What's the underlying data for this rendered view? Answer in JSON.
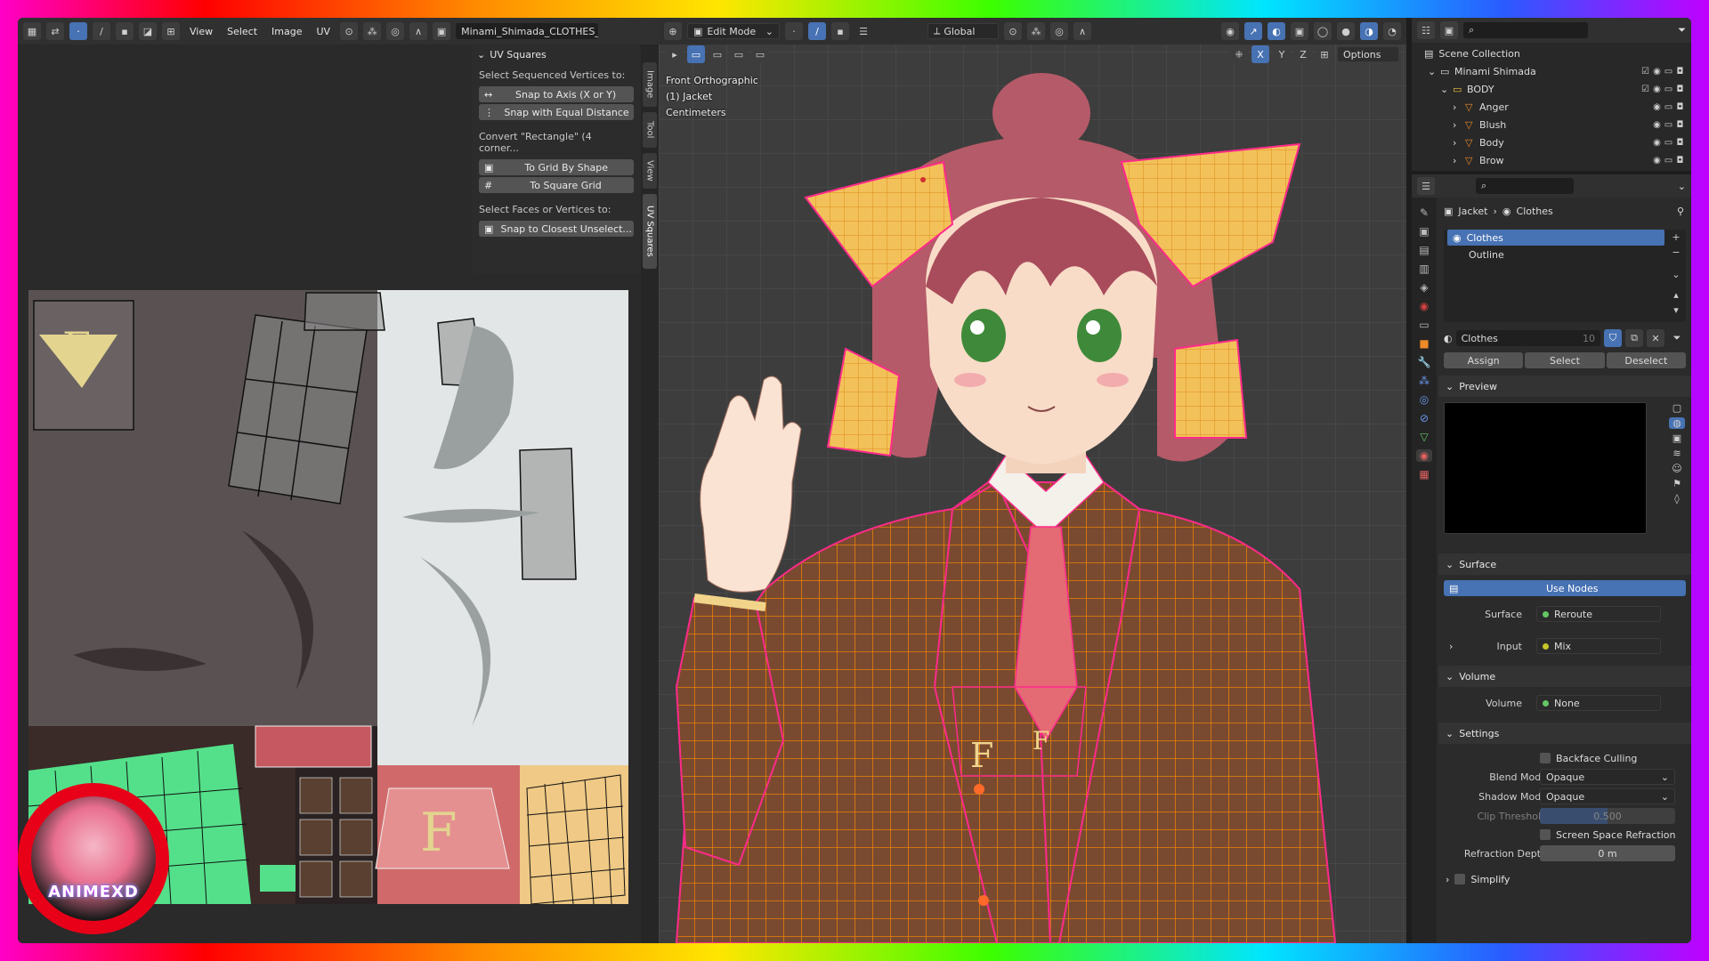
{
  "uv_editor": {
    "menus": [
      "View",
      "Select",
      "Image",
      "UV"
    ],
    "image_name": "Minami_Shimada_CLOTHES_BA",
    "npanel": {
      "title": "UV Squares",
      "sections": [
        {
          "label": "Select Sequenced Vertices to:",
          "buttons": [
            {
              "icon": "↔",
              "text": "Snap to Axis (X or Y)"
            },
            {
              "icon": "⋮",
              "text": "Snap with Equal Distance"
            }
          ]
        },
        {
          "label": "Convert \"Rectangle\" (4 corner...",
          "buttons": [
            {
              "icon": "▣",
              "text": "To Grid By Shape"
            },
            {
              "icon": "#",
              "text": "To Square Grid"
            }
          ]
        },
        {
          "label": "Select Faces or Vertices to:",
          "buttons": [
            {
              "icon": "▣",
              "text": "Snap to Closest Unselect..."
            }
          ]
        }
      ]
    },
    "tabs": [
      "Image",
      "Tool",
      "View",
      "UV Squares"
    ]
  },
  "viewport": {
    "mode": "Edit Mode",
    "orientation": "Global",
    "axes": [
      "X",
      "Y",
      "Z"
    ],
    "options_label": "Options",
    "overlay_lines": [
      "Front Orthographic",
      "(1) Jacket",
      "Centimeters"
    ]
  },
  "outliner": {
    "search_placeholder": "",
    "root": "Scene Collection",
    "items": [
      {
        "name": "Minami Shimada",
        "depth": 1,
        "icon": "collection-icon"
      },
      {
        "name": "BODY",
        "depth": 2,
        "icon": "collection-icon"
      },
      {
        "name": "Anger",
        "depth": 3,
        "icon": "mesh-icon"
      },
      {
        "name": "Blush",
        "depth": 3,
        "icon": "mesh-icon"
      },
      {
        "name": "Body",
        "depth": 3,
        "icon": "mesh-icon"
      },
      {
        "name": "Brow",
        "depth": 3,
        "icon": "mesh-icon"
      }
    ]
  },
  "properties": {
    "breadcrumb": [
      "Jacket",
      "Clothes"
    ],
    "slots": [
      "Clothes",
      "Outline"
    ],
    "material_name": "Clothes",
    "user_count": "10",
    "assign_buttons": [
      "Assign",
      "Select",
      "Deselect"
    ],
    "preview_label": "Preview",
    "surface_label": "Surface",
    "use_nodes_label": "Use Nodes",
    "surface_rows": [
      {
        "label": "Surface",
        "value": "Reroute"
      },
      {
        "label": "Input",
        "value": "Mix"
      }
    ],
    "volume_label": "Volume",
    "volume_row": {
      "label": "Volume",
      "value": "None"
    },
    "settings_label": "Settings",
    "backface_culling": "Backface Culling",
    "blend_mode": {
      "label": "Blend Mode",
      "value": "Opaque"
    },
    "shadow_mode": {
      "label": "Shadow Mode",
      "value": "Opaque"
    },
    "clip_threshold": {
      "label": "Clip Threshold",
      "value": "0.500"
    },
    "screen_space_refraction": "Screen Space Refraction",
    "refraction_depth": {
      "label": "Refraction Depth",
      "value": "0 m"
    },
    "simplify": "Simplify"
  },
  "logo_text": "ANIMEXD",
  "colors": {
    "accent": "#4772b3",
    "wire": "#ff8a00",
    "selected_edge": "#ff2a8a"
  }
}
